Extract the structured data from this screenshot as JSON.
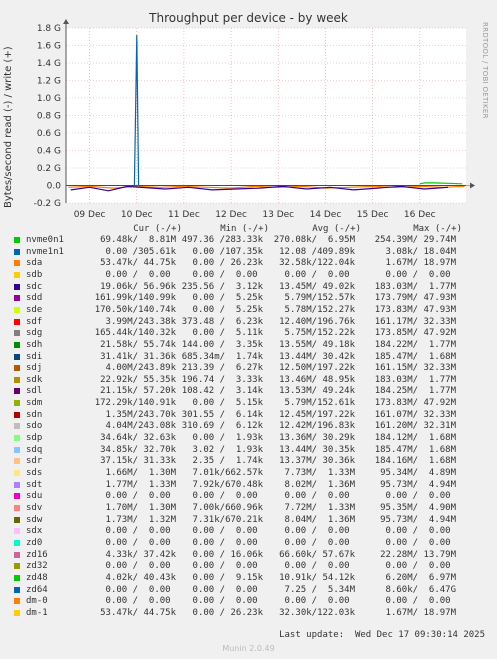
{
  "chart_data": {
    "type": "line",
    "title": "Throughput per device - by week",
    "ylabel": "Bytes/second read (-) / write (+)",
    "y_tick_labels": [
      "1.8 G",
      "1.6 G",
      "1.4 G",
      "1.2 G",
      "1.0 G",
      "0.8 G",
      "0.6 G",
      "0.4 G",
      "0.2 G",
      "0.0",
      "-0.2 G"
    ],
    "y_tick_values": [
      1.8,
      1.6,
      1.4,
      1.2,
      1.0,
      0.8,
      0.6,
      0.4,
      0.2,
      0.0,
      -0.2
    ],
    "ylim": [
      -0.2,
      1.8
    ],
    "y_unit": "G",
    "x_tick_labels": [
      "09 Dec",
      "10 Dec",
      "11 Dec",
      "12 Dec",
      "13 Dec",
      "14 Dec",
      "15 Dec",
      "16 Dec"
    ],
    "x_tick_values": [
      1,
      2,
      3,
      4,
      5,
      6,
      7,
      8
    ],
    "xlim": [
      0.5,
      8.98
    ],
    "grid": true,
    "series": [
      {
        "name": "nvme1n1",
        "color": "#0066b3",
        "x": [
          1.95,
          2.0,
          2.04
        ],
        "values": [
          0.0,
          1.72,
          0.0
        ]
      },
      {
        "name": "nvme0n1",
        "color": "#00cc00",
        "x": [
          8.0,
          8.1,
          8.3,
          8.6,
          8.9
        ],
        "values": [
          0.02,
          0.03,
          0.03,
          0.025,
          0.02
        ]
      },
      {
        "name": "sda",
        "color": "#ff8000",
        "x": [
          0.55,
          1.0,
          1.5,
          2.0,
          2.5,
          3.0,
          3.5,
          4.0,
          4.5,
          5.0,
          5.5,
          6.0,
          6.5,
          7.0,
          7.5,
          8.0,
          8.5,
          8.95
        ],
        "values": [
          -0.02,
          -0.01,
          -0.03,
          -0.01,
          -0.02,
          -0.01,
          -0.02,
          -0.03,
          -0.01,
          -0.02,
          -0.01,
          -0.03,
          -0.02,
          -0.01,
          -0.02,
          -0.01,
          -0.02,
          -0.01
        ]
      },
      {
        "name": "sdd",
        "color": "#330099",
        "x": [
          0.6,
          1.0,
          1.4,
          1.8,
          2.6,
          3.1,
          3.6,
          4.6,
          5.1,
          5.6,
          6.1,
          6.6,
          7.1,
          7.6,
          8.1,
          8.6
        ],
        "values": [
          -0.05,
          -0.02,
          -0.06,
          -0.01,
          -0.04,
          -0.02,
          -0.05,
          -0.03,
          -0.01,
          -0.04,
          -0.02,
          -0.05,
          -0.03,
          -0.01,
          -0.04,
          -0.02
        ]
      }
    ],
    "legend": {
      "columns": [
        "Cur (-/+)",
        "Min (-/+)",
        "Avg (-/+)",
        "Max (-/+)"
      ],
      "placement": "bottom",
      "rows": [
        {
          "name": "nvme0n1",
          "color": "#00cc00",
          "cur": "69.48k/  8.81M",
          "min": "497.36 /283.33k",
          "avg": "270.08k/  6.95M",
          "max": "254.39M/ 29.74M"
        },
        {
          "name": "nvme1n1",
          "color": "#0066b3",
          "cur": " 0.00 /305.61k",
          "min": "  0.00 /107.35k",
          "avg": " 12.08 /409.89k",
          "max": "  3.08k/ 18.04M"
        },
        {
          "name": "sda",
          "color": "#ff8000",
          "cur": "53.47k/ 44.75k",
          "min": "  0.00 / 26.23k",
          "avg": "32.58k/122.04k",
          "max": "  1.67M/ 18.97M"
        },
        {
          "name": "sdb",
          "color": "#ffcc00",
          "cur": " 0.00 /  0.00 ",
          "min": "  0.00 /  0.00 ",
          "avg": "  0.00 /  0.00 ",
          "max": "  0.00 /  0.00 "
        },
        {
          "name": "sdc",
          "color": "#330099",
          "cur": "19.06k/ 56.96k",
          "min": "235.56 /  3.12k",
          "avg": " 13.45M/ 49.02k",
          "max": "183.03M/  1.77M"
        },
        {
          "name": "sdd",
          "color": "#990099",
          "cur": "161.99k/140.99k",
          "min": "  0.00 /  5.25k",
          "avg": "  5.79M/152.57k",
          "max": "173.79M/ 47.93M"
        },
        {
          "name": "sde",
          "color": "#ccff00",
          "cur": "170.50k/140.74k",
          "min": "  0.00 /  5.25k",
          "avg": "  5.78M/152.27k",
          "max": "173.83M/ 47.93M"
        },
        {
          "name": "sdf",
          "color": "#ff0000",
          "cur": "  3.99M/243.38k",
          "min": "373.48 /  6.23k",
          "avg": " 12.40M/196.76k",
          "max": "161.17M/ 32.33M"
        },
        {
          "name": "sdg",
          "color": "#808080",
          "cur": "165.44k/140.32k",
          "min": "  0.00 /  5.11k",
          "avg": "  5.75M/152.22k",
          "max": "173.85M/ 47.92M"
        },
        {
          "name": "sdh",
          "color": "#008f00",
          "cur": "21.58k/ 55.74k",
          "min": "144.00 /  3.35k",
          "avg": " 13.55M/ 49.18k",
          "max": "184.22M/  1.77M"
        },
        {
          "name": "sdi",
          "color": "#00487d",
          "cur": "31.41k/ 31.36k",
          "min": "685.34m/  1.74k",
          "avg": " 13.44M/ 30.42k",
          "max": "185.47M/  1.68M"
        },
        {
          "name": "sdj",
          "color": "#b35a00",
          "cur": "  4.00M/243.89k",
          "min": "213.39 /  6.27k",
          "avg": " 12.50M/197.22k",
          "max": "161.15M/ 32.33M"
        },
        {
          "name": "sdk",
          "color": "#b38f00",
          "cur": "22.92k/ 55.35k",
          "min": "196.74 /  3.33k",
          "avg": " 13.46M/ 48.95k",
          "max": "183.03M/  1.77M"
        },
        {
          "name": "sdl",
          "color": "#6b006b",
          "cur": "21.15k/ 57.20k",
          "min": "108.42 /  3.14k",
          "avg": " 13.53M/ 49.24k",
          "max": "184.25M/  1.77M"
        },
        {
          "name": "sdm",
          "color": "#8fb300",
          "cur": "172.29k/140.91k",
          "min": "  0.00 /  5.15k",
          "avg": "  5.79M/152.61k",
          "max": "173.83M/ 47.92M"
        },
        {
          "name": "sdn",
          "color": "#b30000",
          "cur": "  1.35M/243.70k",
          "min": "301.55 /  6.14k",
          "avg": " 12.45M/197.22k",
          "max": "161.07M/ 32.33M"
        },
        {
          "name": "sdo",
          "color": "#bebebe",
          "cur": "  4.04M/243.08k",
          "min": "310.69 /  6.12k",
          "avg": " 12.42M/196.83k",
          "max": "161.20M/ 32.31M"
        },
        {
          "name": "sdp",
          "color": "#80ff80",
          "cur": "34.64k/ 32.63k",
          "min": "  0.00 /  1.93k",
          "avg": " 13.36M/ 30.29k",
          "max": "184.12M/  1.68M"
        },
        {
          "name": "sdq",
          "color": "#80c9ff",
          "cur": "34.85k/ 32.70k",
          "min": "  3.02 /  1.93k",
          "avg": " 13.44M/ 30.35k",
          "max": "185.47M/  1.68M"
        },
        {
          "name": "sdr",
          "color": "#ffc080",
          "cur": "37.15k/ 31.33k",
          "min": "  2.35 /  1.74k",
          "avg": " 13.37M/ 30.36k",
          "max": "184.16M/  1.68M"
        },
        {
          "name": "sds",
          "color": "#ffe680",
          "cur": "  1.66M/  1.30M",
          "min": "  7.01k/662.57k",
          "avg": "  7.73M/  1.33M",
          "max": " 95.34M/  4.89M"
        },
        {
          "name": "sdt",
          "color": "#aa80ff",
          "cur": "  1.77M/  1.33M",
          "min": "  7.92k/670.48k",
          "avg": "  8.02M/  1.36M",
          "max": " 95.73M/  4.94M"
        },
        {
          "name": "sdu",
          "color": "#ee00cc",
          "cur": "  0.00 /  0.00 ",
          "min": "  0.00 /  0.00 ",
          "avg": "  0.00 /  0.00 ",
          "max": "  0.00 /  0.00 "
        },
        {
          "name": "sdv",
          "color": "#ff8080",
          "cur": "  1.70M/  1.30M",
          "min": "  7.00k/660.96k",
          "avg": "  7.72M/  1.33M",
          "max": " 95.35M/  4.90M"
        },
        {
          "name": "sdw",
          "color": "#666600",
          "cur": "  1.73M/  1.32M",
          "min": "  7.31k/670.21k",
          "avg": "  8.04M/  1.36M",
          "max": " 95.73M/  4.94M"
        },
        {
          "name": "sdx",
          "color": "#ffbfff",
          "cur": "  0.00 /  0.00 ",
          "min": "  0.00 /  0.00 ",
          "avg": "  0.00 /  0.00 ",
          "max": "  0.00 /  0.00 "
        },
        {
          "name": "zd0",
          "color": "#00ffcc",
          "cur": "  0.00 /  0.00 ",
          "min": "  0.00 /  0.00 ",
          "avg": "  0.00 /  0.00 ",
          "max": "  0.00 /  0.00 "
        },
        {
          "name": "zd16",
          "color": "#cc6699",
          "cur": "  4.33k/ 37.42k",
          "min": "  0.00 / 16.06k",
          "avg": " 66.60k/ 57.67k",
          "max": " 22.28M/ 13.79M"
        },
        {
          "name": "zd32",
          "color": "#999900",
          "cur": "  0.00 /  0.00 ",
          "min": "  0.00 /  0.00 ",
          "avg": "  0.00 /  0.00 ",
          "max": "  0.00 /  0.00 "
        },
        {
          "name": "zd48",
          "color": "#00cc00",
          "cur": "  4.02k/ 40.43k",
          "min": "  0.00 /  9.15k",
          "avg": " 10.91k/ 54.12k",
          "max": "  6.20M/  6.97M"
        },
        {
          "name": "zd64",
          "color": "#0066b3",
          "cur": "  0.00 /  0.00 ",
          "min": "  0.00 /  0.00 ",
          "avg": "  7.25 /  5.34M",
          "max": "  8.60k/  6.47G"
        },
        {
          "name": "dm-0",
          "color": "#ff8000",
          "cur": "  0.00 /  0.00 ",
          "min": "  0.00 /  0.00 ",
          "avg": "  0.00 /  0.00 ",
          "max": "  0.00 /  0.00 "
        },
        {
          "name": "dm-1",
          "color": "#ffcc00",
          "cur": "53.47k/ 44.75k",
          "min": "  0.00 / 26.23k",
          "avg": "32.30k/122.03k",
          "max": "  1.67M/ 18.97M"
        }
      ]
    }
  },
  "side_label": "RRDTOOL / TOBI OETIKER",
  "last_update": "Last update:  Wed Dec 17 09:30:14 2025",
  "footer": "Munin 2.0.49",
  "colors": {
    "background": "#f0f0f0",
    "plot_bg": "#ffffff",
    "grid": "#e0a0a0",
    "text": "#333333"
  }
}
